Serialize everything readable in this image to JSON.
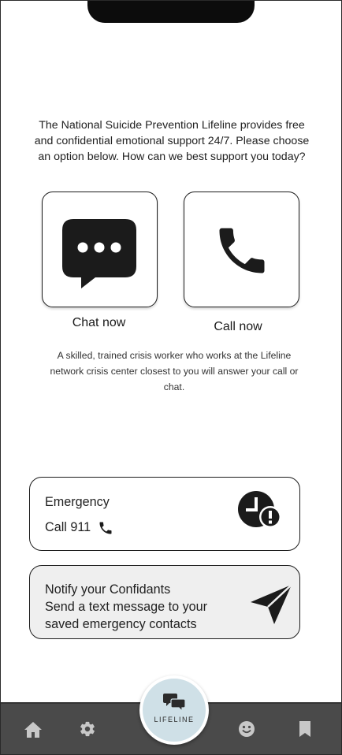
{
  "intro": {
    "text": "The National Suicide Prevention Lifeline provides free and confidential emotional support 24/7. Please choose an option below. How can we best support you today?"
  },
  "options": {
    "chat_label": "Chat now",
    "call_label": "Call now"
  },
  "note": {
    "text": "A skilled, trained crisis worker who works at the Lifeline network crisis center closest to you will answer your call or chat."
  },
  "emergency_card": {
    "title": "Emergency",
    "action": "Call 911"
  },
  "notify_card": {
    "line1": "Notify your Confidants",
    "line2": "Send a text message to your",
    "line3": "saved emergency contacts"
  },
  "nav": {
    "center_label": "LIFELINE",
    "items": [
      "home-icon",
      "gear-icon",
      "smiley-icon",
      "bookmark-icon"
    ]
  },
  "colors": {
    "navbar": "#4a4a4a",
    "lifeline_button": "#cfe0e7",
    "icon_dark": "#1b1b1b",
    "notify_card_bg": "#efefef"
  }
}
